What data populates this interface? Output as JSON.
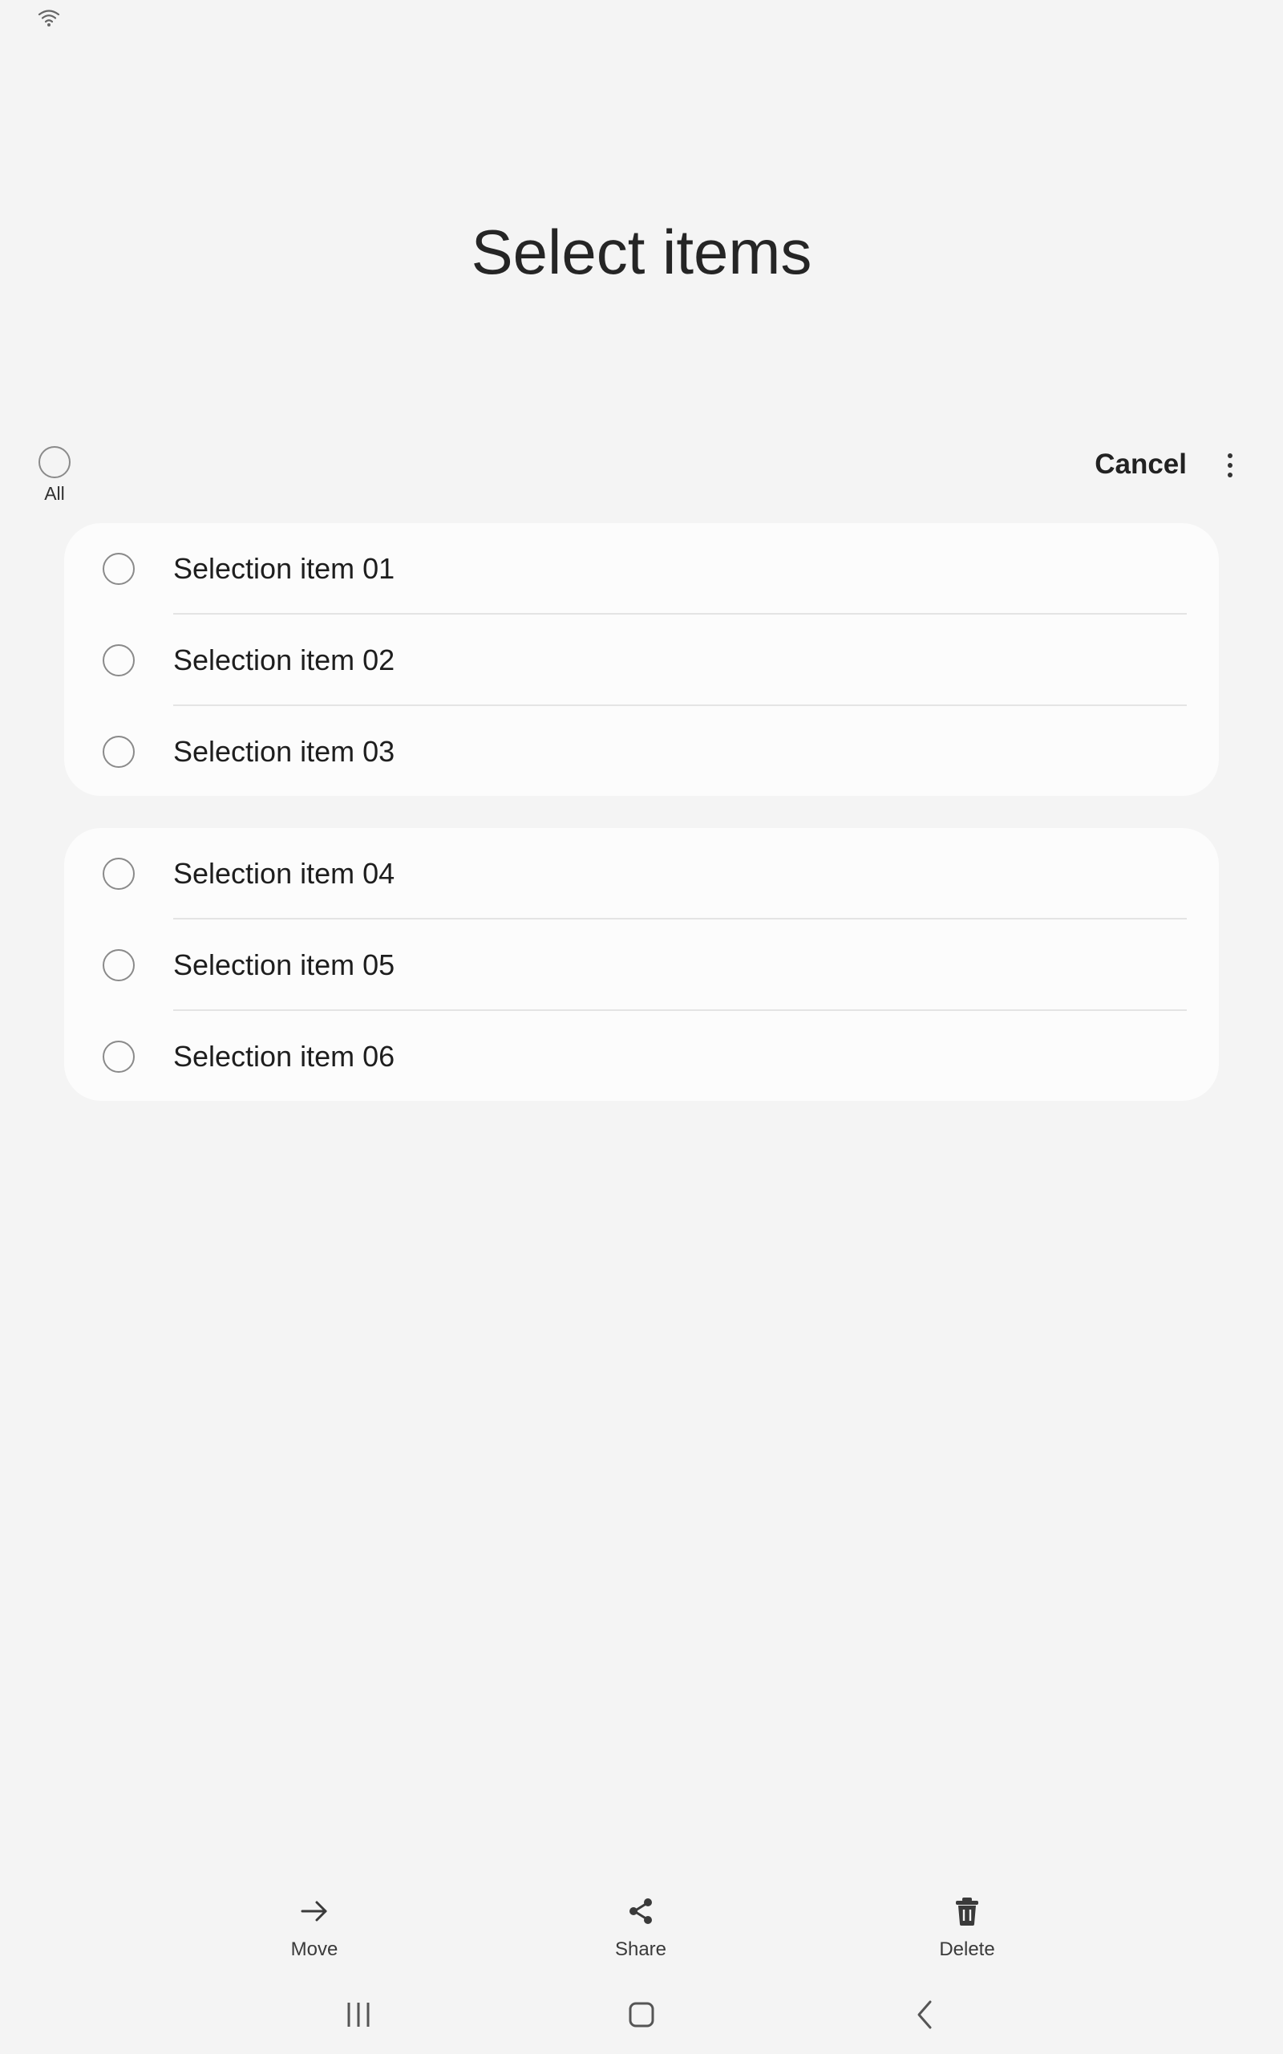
{
  "header": {
    "title": "Select items"
  },
  "toolbar": {
    "select_all_label": "All",
    "cancel_label": "Cancel"
  },
  "lists": [
    {
      "items": [
        {
          "label": "Selection item 01",
          "checked": false
        },
        {
          "label": "Selection item 02",
          "checked": false
        },
        {
          "label": "Selection item 03",
          "checked": false
        }
      ]
    },
    {
      "items": [
        {
          "label": "Selection item 04",
          "checked": false
        },
        {
          "label": "Selection item 05",
          "checked": false
        },
        {
          "label": "Selection item 06",
          "checked": false
        }
      ]
    }
  ],
  "bottom_actions": [
    {
      "label": "Move",
      "icon": "arrow-right-icon"
    },
    {
      "label": "Share",
      "icon": "share-icon"
    },
    {
      "label": "Delete",
      "icon": "trash-icon"
    }
  ],
  "navigation": [
    {
      "icon": "recent-apps-icon"
    },
    {
      "icon": "home-icon"
    },
    {
      "icon": "back-icon"
    }
  ],
  "colors": {
    "background": "#f4f4f4",
    "card": "#fcfcfc",
    "radio_border": "#8a8a8a"
  }
}
